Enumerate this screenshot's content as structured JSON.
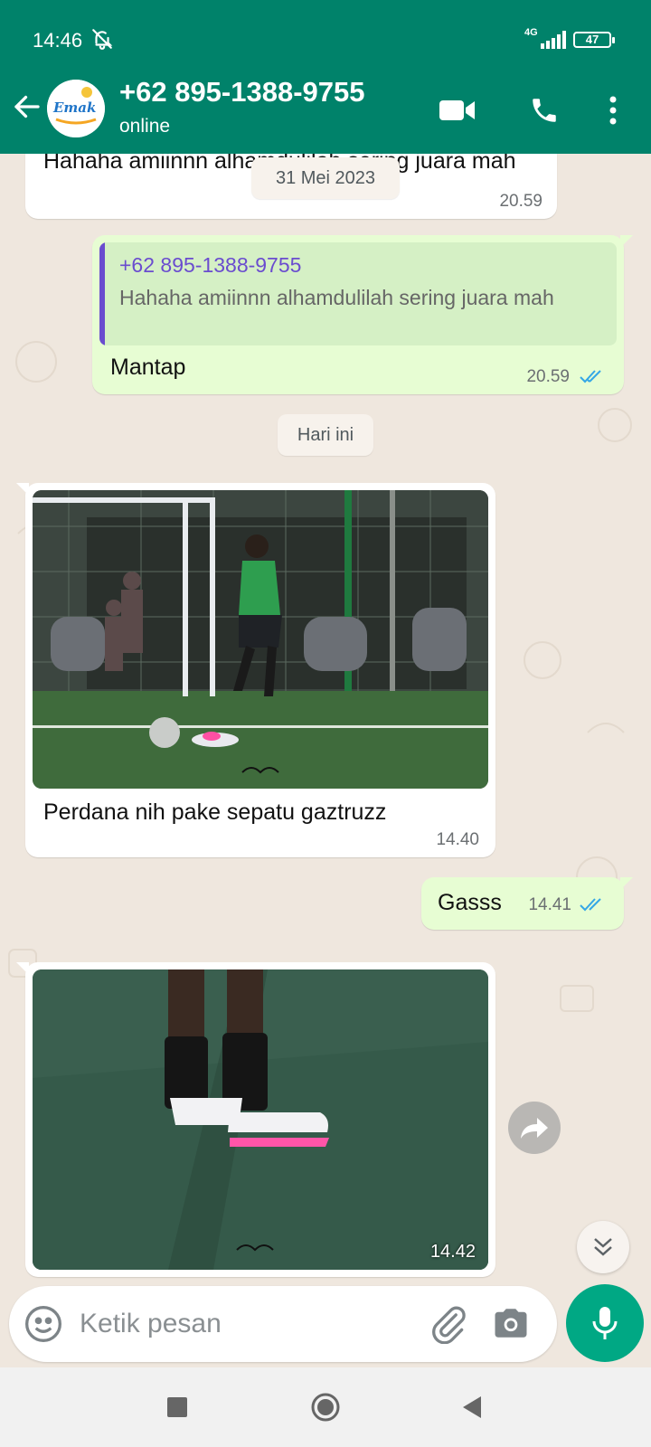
{
  "status_bar": {
    "time": "14:46",
    "network": "4G",
    "battery": "47"
  },
  "header": {
    "contact_name": "+62 895-1388-9755",
    "status": "online",
    "avatar_text": "Emak"
  },
  "messages": [
    {
      "id": 1,
      "direction": "in",
      "text": "Hahaha amiinnn alhamdulilah sering juara mah",
      "time": "20.59"
    },
    {
      "id": 2,
      "direction": "out",
      "quote_author": "+62 895-1388-9755",
      "quote_text": "Hahaha amiinnn alhamdulilah sering juara mah",
      "text": "Mantap",
      "time": "20.59",
      "read": true
    },
    {
      "id": 3,
      "direction": "in",
      "image": "photo-player-kicking-ball",
      "text": "Perdana nih pake sepatu gaztruzz",
      "time": "14.40"
    },
    {
      "id": 4,
      "direction": "out",
      "text": "Gasss",
      "time": "14.41",
      "read": true
    },
    {
      "id": 5,
      "direction": "in",
      "image": "photo-football-boots",
      "time": "14.42"
    }
  ],
  "date_chips": {
    "sticky": "31 Mei 2023",
    "today": "Hari ini"
  },
  "composer": {
    "placeholder": "Ketik pesan"
  },
  "colors": {
    "header": "#00826a",
    "outgoing_bubble": "#e7fdd3",
    "accent": "#00a884",
    "quote_author": "#6a4ccf",
    "read_ticks": "#34a7e6"
  }
}
